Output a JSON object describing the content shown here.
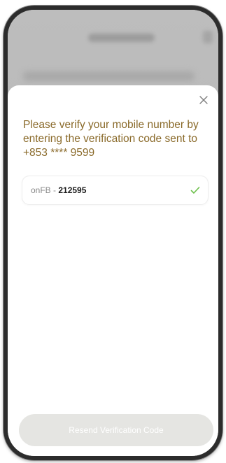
{
  "modal": {
    "close_icon": "close-icon",
    "message": "Please verify your mobile number by entering the verification code sent to +853 **** 9599",
    "code_prefix": "onFB",
    "code_separator": " - ",
    "code_value": "212595",
    "verified_icon": "check-icon",
    "resend_label": "Resend Verification Code"
  },
  "colors": {
    "accent_text": "#8a6a2a",
    "success": "#6cc04a",
    "disabled_button": "#e5e5e2",
    "overlay": "#b9b9b9"
  }
}
